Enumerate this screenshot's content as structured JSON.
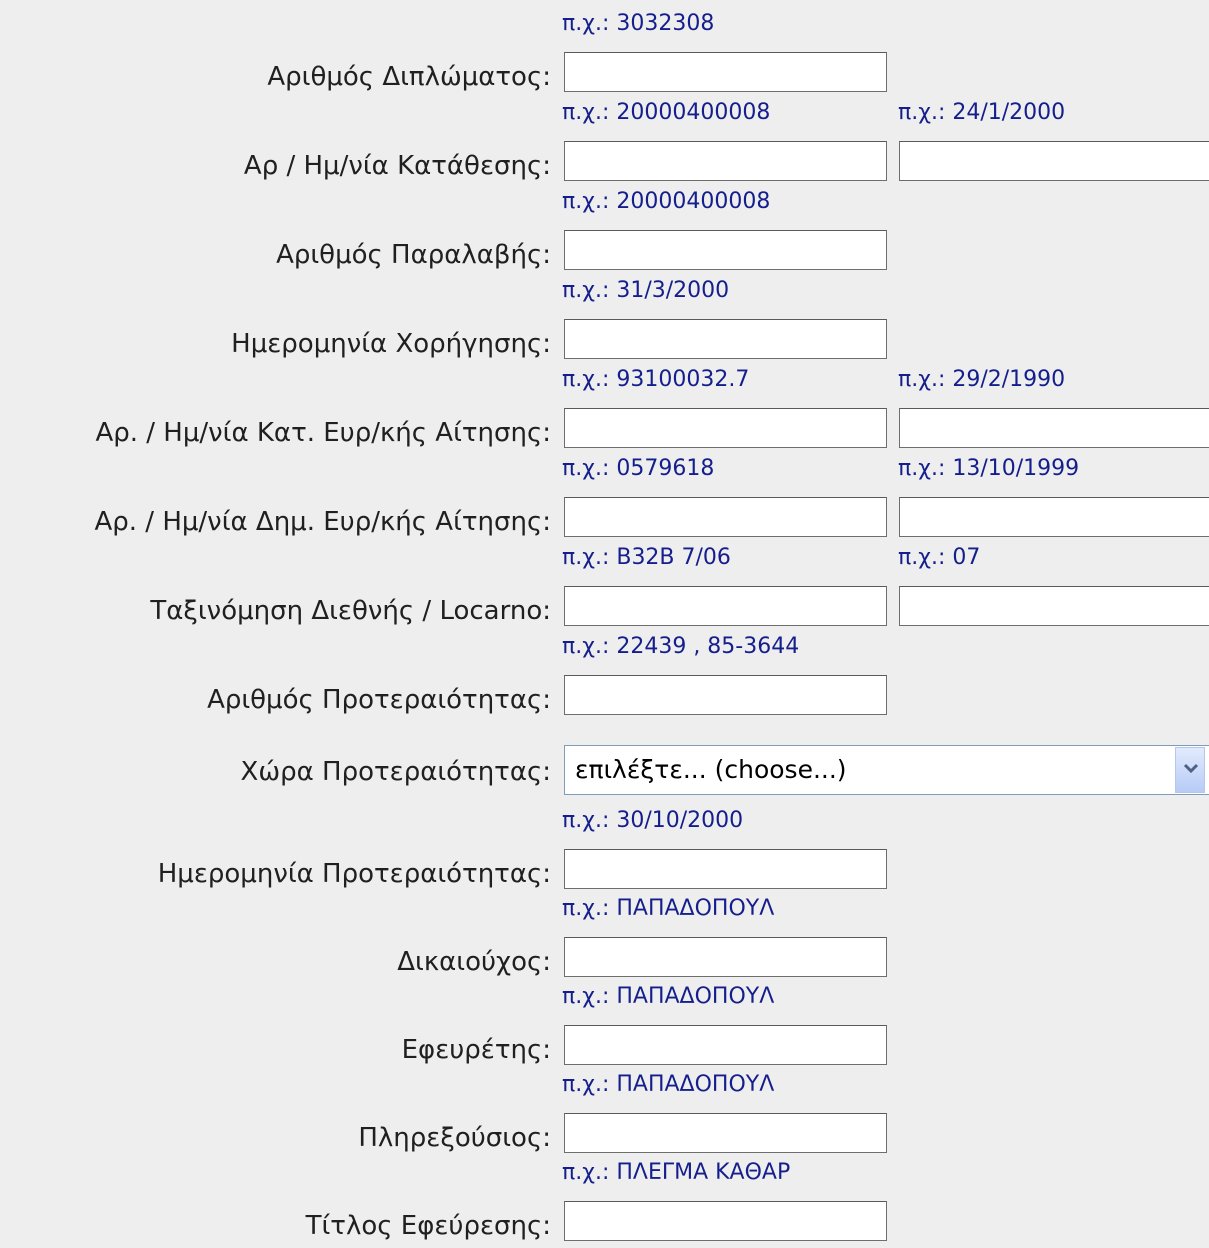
{
  "form": {
    "rows": [
      {
        "label": "Αριθμός Διπλώματος:",
        "hint1": "π.χ.: 3032308",
        "value1": ""
      },
      {
        "label": "Αρ / Ημ/νία Κατάθεσης:",
        "hint1": "π.χ.: 20000400008",
        "value1": "",
        "hint2": "π.χ.: 24/1/2000",
        "value2": ""
      },
      {
        "label": "Αριθμός Παραλαβής:",
        "hint1": "π.χ.: 20000400008",
        "value1": ""
      },
      {
        "label": "Ημερομηνία Χορήγησης:",
        "hint1": "π.χ.: 31/3/2000",
        "value1": ""
      },
      {
        "label": "Αρ. / Ημ/νία Κατ. Ευρ/κής Αίτησης:",
        "hint1": "π.χ.: 93100032.7",
        "value1": "",
        "hint2": "π.χ.: 29/2/1990",
        "value2": ""
      },
      {
        "label": "Αρ. / Ημ/νία Δημ. Ευρ/κής Αίτησης:",
        "hint1": "π.χ.: 0579618",
        "value1": "",
        "hint2": "π.χ.: 13/10/1999",
        "value2": ""
      },
      {
        "label": "Ταξινόμηση Διεθνής / Locarno:",
        "hint1": "π.χ.: B32B 7/06",
        "value1": "",
        "hint2": "π.χ.: 07",
        "value2": ""
      },
      {
        "label": "Αριθμός Προτεραιότητας:",
        "hint1": "π.χ.: 22439 , 85-3644",
        "value1": ""
      }
    ],
    "country": {
      "label": "Χώρα Προτεραιότητας:",
      "selected": "επιλέξτε... (choose...)"
    },
    "rows_after": [
      {
        "label": "Ημερομηνία Προτεραιότητας:",
        "hint1": "π.χ.: 30/10/2000",
        "value1": ""
      },
      {
        "label": "Δικαιούχος:",
        "hint1": "π.χ.: ΠΑΠΑΔΟΠΟΥΛ",
        "value1": ""
      },
      {
        "label": "Εφευρέτης:",
        "hint1": "π.χ.: ΠΑΠΑΔΟΠΟΥΛ",
        "value1": ""
      },
      {
        "label": "Πληρεξούσιος:",
        "hint1": "π.χ.: ΠΑΠΑΔΟΠΟΥΛ",
        "value1": ""
      },
      {
        "label": "Τίτλος Εφεύρεσης:",
        "hint1": "π.χ.: ΠΛΕΓΜΑ ΚΑΘΑΡ",
        "value1": ""
      }
    ]
  },
  "colors": {
    "background": "#eeeeee",
    "hint_text": "#141e8c",
    "label_text": "#202020"
  },
  "icons": {
    "dropdown": "chevron-down-icon"
  }
}
